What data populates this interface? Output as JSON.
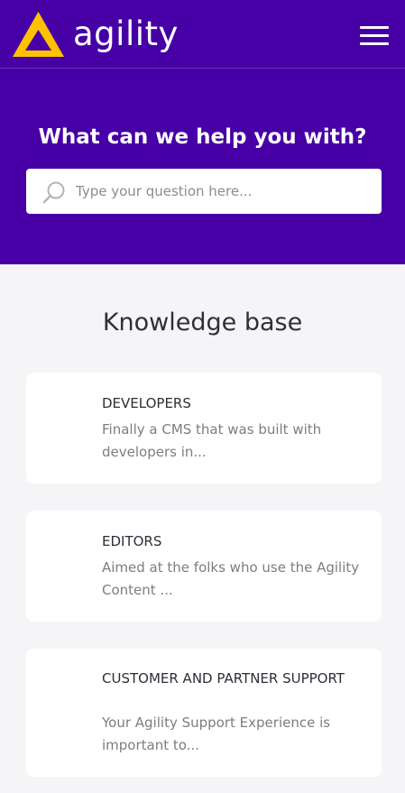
{
  "header": {
    "brand": "agility",
    "menu_icon": "hamburger-menu-icon",
    "logo_icon": "agility-triangle-logo",
    "colors": {
      "background": "#4600a5",
      "logo_accent": "#ffc200"
    }
  },
  "hero": {
    "title": "What can we help you with?",
    "search": {
      "placeholder": "Type your question here...",
      "value": "",
      "icon": "search-icon"
    }
  },
  "knowledge_base": {
    "title": "Knowledge base",
    "categories": [
      {
        "title": "DEVELOPERS",
        "description": "Finally a CMS that was built with developers in..."
      },
      {
        "title": "EDITORS",
        "description": "Aimed at the folks who use the Agility Content ..."
      },
      {
        "title": "CUSTOMER AND PARTNER SUPPORT",
        "description": "Your Agility Support Experience is important to..."
      }
    ]
  }
}
